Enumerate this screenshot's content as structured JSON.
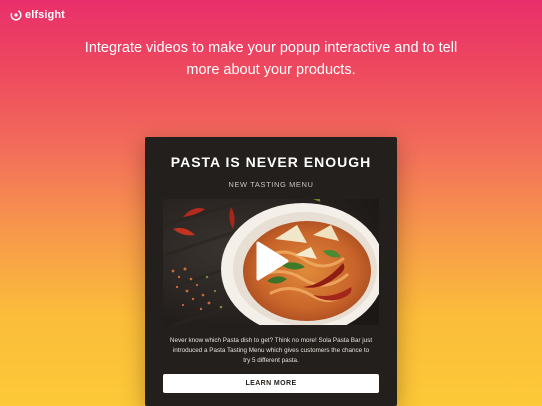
{
  "brand": {
    "logo_text": "elfsight",
    "logo_icon": "elfsight-logo-icon"
  },
  "headline": {
    "line1": "Integrate videos to make your popup interactive and to tell",
    "line2": "more about your products."
  },
  "popup": {
    "title": "PASTA IS NEVER ENOUGH",
    "subtitle": "NEW TASTING MENU",
    "video": {
      "play_icon": "play-icon"
    },
    "description": {
      "line1": "Never know which Pasta dish to get? Think no more! Sola Pasta Bar just",
      "line2": "introduced a Pasta Tasting Menu which gives customers the chance to",
      "line3": "try 5 different pasta."
    },
    "cta_label": "LEARN MORE"
  },
  "colors": {
    "gradient_top": "#e92f6b",
    "gradient_bottom": "#fcc938",
    "popup_bg": "#231f1c",
    "button_bg": "#ffffff"
  }
}
